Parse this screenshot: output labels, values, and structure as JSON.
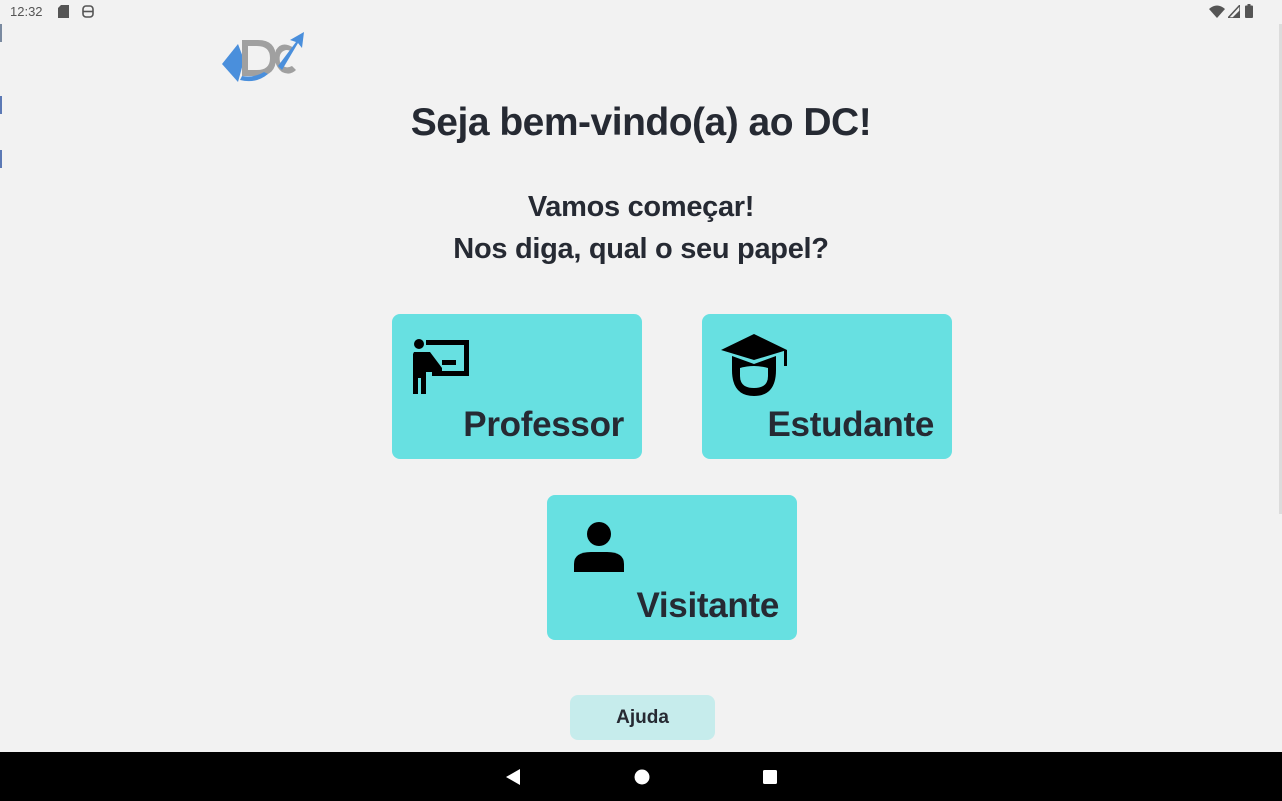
{
  "status_bar": {
    "time": "12:32",
    "left_icons": [
      "sd-card-icon",
      "app-notification-icon"
    ],
    "right_icons": [
      "wifi-icon",
      "signal-icon",
      "battery-icon"
    ]
  },
  "logo": {
    "text": "DC",
    "colors": {
      "primary": "#4a8fdc",
      "secondary": "#9a9a9a"
    }
  },
  "welcome": {
    "title": "Seja bem-vindo(a) ao DC!",
    "subtitle_line1": "Vamos começar!",
    "subtitle_line2": "Nos diga, qual o seu papel?"
  },
  "roles": [
    {
      "label": "Professor",
      "icon": "teacher-icon"
    },
    {
      "label": "Estudante",
      "icon": "graduation-student-icon"
    },
    {
      "label": "Visitante",
      "icon": "person-icon"
    }
  ],
  "help": {
    "label": "Ajuda"
  },
  "navigation": {
    "buttons": [
      "back-icon",
      "home-icon",
      "recents-icon"
    ]
  },
  "colors": {
    "background": "#f2f2f2",
    "card": "#67e0e1",
    "help_button": "#c6ecec",
    "text": "#262a33"
  }
}
